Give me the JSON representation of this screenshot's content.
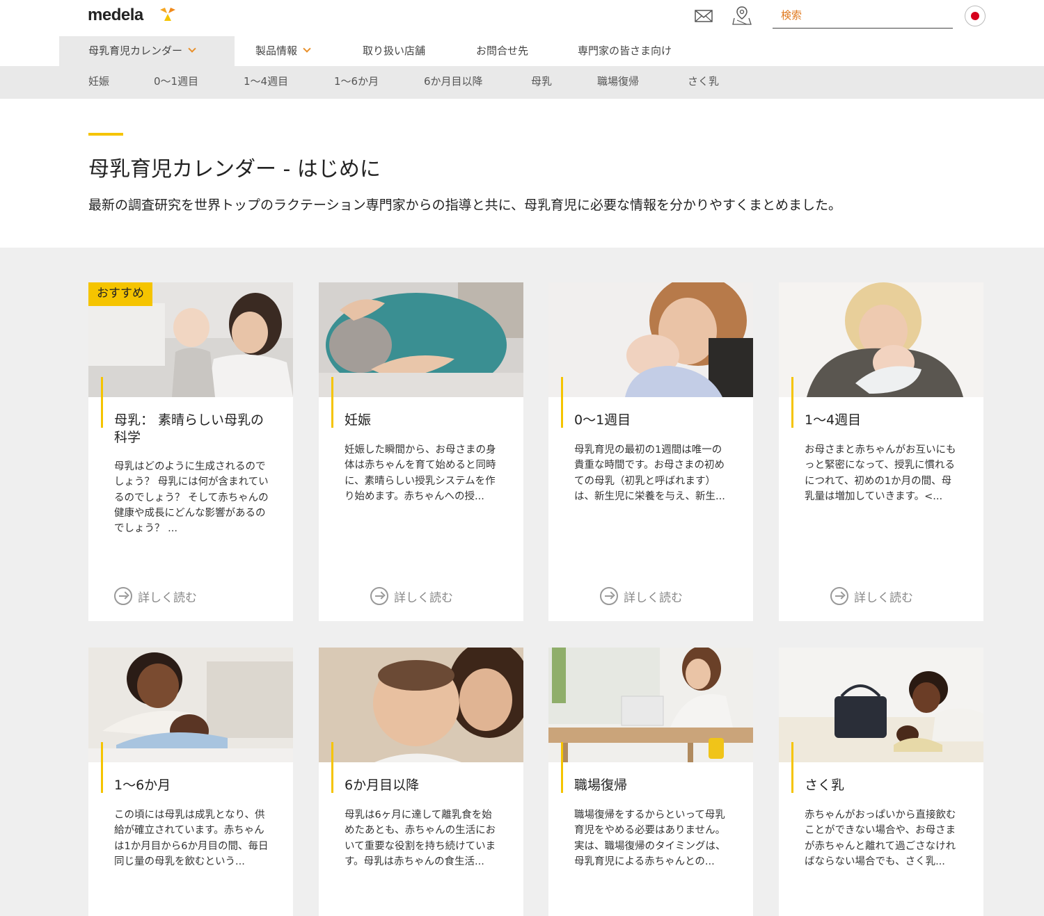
{
  "header": {
    "logo_text": "medela",
    "search_placeholder": "検索",
    "icons": [
      "mail-icon",
      "map-pin-icon",
      "japan-flag-icon"
    ]
  },
  "main_nav": [
    {
      "label": "母乳育児カレンダー",
      "dropdown": true,
      "active": true
    },
    {
      "label": "製品情報",
      "dropdown": true,
      "active": false
    },
    {
      "label": "取り扱い店舗",
      "dropdown": false,
      "active": false
    },
    {
      "label": "お問合せ先",
      "dropdown": false,
      "active": false
    },
    {
      "label": "専門家の皆さま向け",
      "dropdown": false,
      "active": false
    }
  ],
  "sub_nav": [
    "妊娠",
    "0～1週目",
    "1～4週目",
    "1～6か月",
    "6か月目以降",
    "母乳",
    "職場復帰",
    "さく乳"
  ],
  "intro": {
    "title": "母乳育児カレンダー - はじめに",
    "text": "最新の調査研究を世界トップのラクテーション専門家からの指導と共に、母乳育児に必要な情報を分かりやすくまとめました。"
  },
  "read_more_label": "詳しく読む",
  "cards": [
    {
      "badge": "おすすめ",
      "title": "母乳： 素晴らしい母乳の科学",
      "desc": "母乳はどのように生成されるのでしょう？ 母乳には何が含まれているのでしょう？ そして赤ちゃんの健康や成長にどんな影響があるのでしょう？ ..."
    },
    {
      "badge": "",
      "title": "妊娠",
      "desc": "妊娠した瞬間から、お母さまの身体は赤ちゃんを育て始めると同時に、素晴らしい授乳システムを作り始めます。赤ちゃんへの授..."
    },
    {
      "badge": "",
      "title": "0～1週目",
      "desc": "母乳育児の最初の1週間は唯一の貴重な時間です。お母さまの初めての母乳（初乳と呼ばれます）は、新生児に栄養を与え、新生..."
    },
    {
      "badge": "",
      "title": "1～4週目",
      "desc": "お母さまと赤ちゃんがお互いにもっと緊密になって、授乳に慣れるにつれて、初めの1か月の間、母乳量は増加していきます。<..."
    },
    {
      "badge": "",
      "title": "1～6か月",
      "desc": "この頃には母乳は成乳となり、供給が確立されています。赤ちゃんは1か月目から6か月目の間、毎日同じ量の母乳を飲むという..."
    },
    {
      "badge": "",
      "title": "6か月目以降",
      "desc": "母乳は6ヶ月に達して離乳食を始めたあとも、赤ちゃんの生活において重要な役割を持ち続けています。母乳は赤ちゃんの食生活..."
    },
    {
      "badge": "",
      "title": "職場復帰",
      "desc": "職場復帰をするからといって母乳育児をやめる必要はありません。実は、職場復帰のタイミングは、母乳育児による赤ちゃんとの..."
    },
    {
      "badge": "",
      "title": "さく乳",
      "desc": "赤ちゃんがおっぱいから直接飲むことができない場合や、お母さまが赤ちゃんと離れて過ごさなければならない場合でも、さく乳..."
    }
  ],
  "colors": {
    "accent_yellow": "#f5c400",
    "orange": "#e8902b",
    "nav_bg": "#e9e9e9",
    "content_bg": "#efefef"
  }
}
